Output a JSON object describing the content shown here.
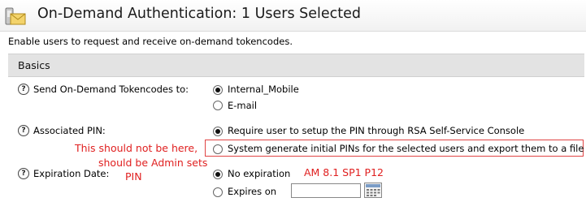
{
  "header": {
    "title": "On-Demand Authentication: 1 Users Selected"
  },
  "description": "Enable users to request and receive on-demand tokencodes.",
  "section": {
    "title": "Basics"
  },
  "fields": {
    "send_tokencodes": {
      "label": "Send On-Demand Tokencodes to:",
      "options": [
        "Internal_Mobile",
        "E-mail"
      ],
      "selected": "Internal_Mobile"
    },
    "associated_pin": {
      "label": "Associated PIN:",
      "options": [
        "Require user to setup the PIN through RSA Self-Service Console",
        "System generate initial PINs for the selected users and export them to a file"
      ],
      "selected": "Require user to setup the PIN through RSA Self-Service Console"
    },
    "expiration_date": {
      "label": "Expiration Date:",
      "options": [
        "No expiration",
        "Expires on"
      ],
      "selected": "No expiration",
      "date_value": ""
    }
  },
  "help_glyph": "?",
  "annotations": {
    "note_line1": "This should not be here,",
    "note_line2": "should be Admin sets",
    "note_line3": "PIN",
    "version": "AM 8.1 SP1 P12"
  },
  "colors": {
    "annotation": "#e02020",
    "section_bg": "#e3e3e3"
  },
  "icons": {
    "title": "mail-envelope-icon",
    "help": "help-icon",
    "calendar": "calendar-icon"
  }
}
